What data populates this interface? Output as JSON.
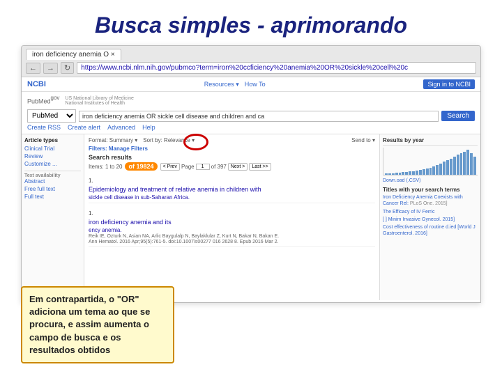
{
  "slide": {
    "title": "Busca simples - aprimorando"
  },
  "browser": {
    "tab_label": "iron deficiency anemia O ×",
    "address": "https://www.ncbi.nlm.nih.gov/pubmco?term=iron%20ccficiency%20anemia%20OR%20sickle%20cell%20c",
    "nav_back": "←",
    "nav_forward": "→",
    "nav_refresh": "↻"
  },
  "ncbi": {
    "logo": "NCBI",
    "nav_resources": "Resources ▾",
    "nav_howto": "How To",
    "sign_in": "Sign in to NCBI"
  },
  "pubmed": {
    "logo": "PubMed",
    "logo_suffix": "gov",
    "tagline": "US National Library of Medicine",
    "tagline2": "National Institutes of Health",
    "db_default": "PubMed",
    "search_query": "iron deficiency anemia OR sickle cell disease and children and ca",
    "search_btn": "Search",
    "link_create_rss": "Create RSS",
    "link_create_alert": "Create alert",
    "link_advanced": "Advanced",
    "link_help": "Help"
  },
  "results": {
    "format_label": "Format: Summary ▾",
    "sort_label": "Sort by: Relevance ▾",
    "send_to": "Send to ▾",
    "filters_label": "Filters: Manage Filters",
    "header": "Search results",
    "items_text": "Items: 1 to 20",
    "count": "of 19824",
    "pagination_prev": "< Prev",
    "pagination_page_label": "Page",
    "pagination_page_value": "1",
    "pagination_of": "of 397",
    "pagination_next": "Next >",
    "pagination_last": "Last >>",
    "items": [
      {
        "number": "1.",
        "title": "Epidemiology and treatment of relative anemia in children with",
        "subtitle": "sickle cell disease in sub-Saharan Africa.",
        "meta": ""
      },
      {
        "number": "1.",
        "title": "iron deficiency anemia and its",
        "subtitle": "ency anemia.",
        "meta": "Reik IE, Ozturk N, Asian NA, Arlic Baygulalp N, Baylaklular Z, Kurt N, Bakar N, Bakan E.\nAnn Hematol. 2016 Apr;95(5):761-5. doi:10.1007/s00277 016 2628 8. Epub 2016 Mar 2."
      }
    ]
  },
  "right_panel": {
    "title": "Results by year",
    "csv_link": "Down.oad (.CSV)",
    "search_terms_title": "Titles with your search terms",
    "terms": [
      {
        "title": "Iron Deficiency Anemia Coexists with Cancer Rel:",
        "year": "PLoS One. 2015]"
      },
      {
        "title": "The Efficacy of IV Ferric",
        "year": ""
      },
      {
        "title": "[ ] Minim Invasive Gynecol. 2015]",
        "year": ""
      },
      {
        "title": "Cost effectiveness of routine d.ied [World J Gastroenterol. 2016]",
        "year": ""
      }
    ],
    "bar_data": [
      1,
      2,
      2,
      3,
      3,
      4,
      4,
      5,
      5,
      6,
      7,
      8,
      9,
      10,
      12,
      14,
      16,
      18,
      20,
      22,
      25,
      28,
      30,
      32,
      35,
      30,
      25
    ]
  },
  "left_panel": {
    "filters_title": "Article types",
    "items": [
      "Clinical Trial",
      "Review",
      "Customize ...",
      "Text availability",
      "Abstract",
      "Free full text",
      "Full text"
    ]
  },
  "annotation": {
    "text": "Em contrapartida, o \"OR\" adiciona um tema ao que se procura, e assim aumenta o campo de busca e os resultados obtidos"
  }
}
